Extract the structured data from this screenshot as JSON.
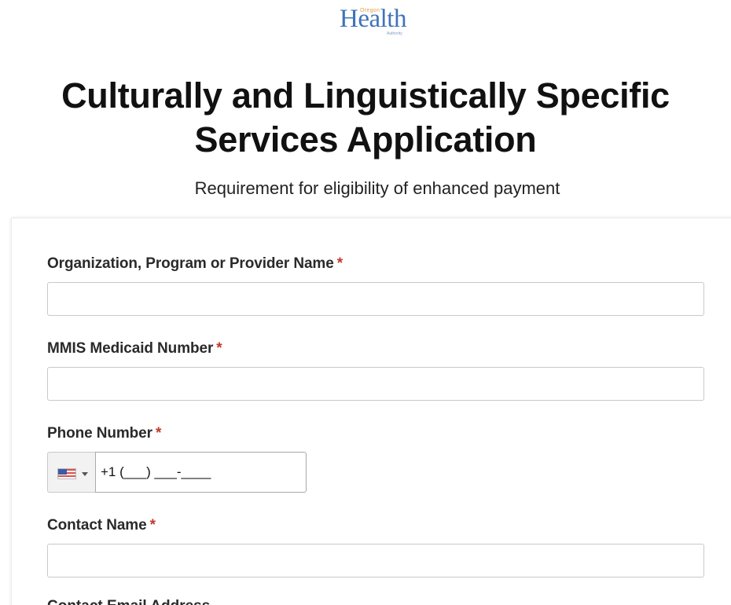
{
  "logo": {
    "word": "Health",
    "small_text": "Oregon",
    "tagline": "Authority"
  },
  "header": {
    "title": "Culturally and Linguistically Specific Services Application",
    "subtitle": "Requirement for eligibility of enhanced payment"
  },
  "form": {
    "required_marker": "*",
    "fields": [
      {
        "label": "Organization, Program or Provider Name",
        "value": "",
        "placeholder": ""
      },
      {
        "label": "MMIS Medicaid Number",
        "value": "",
        "placeholder": ""
      },
      {
        "label": "Phone Number",
        "value": "+1 (___) ___-____",
        "placeholder": "",
        "country": "us-flag-icon"
      },
      {
        "label": "Contact Name",
        "value": "",
        "placeholder": ""
      }
    ],
    "next_label_partial": "Contact Email Address"
  },
  "colors": {
    "logo_blue": "#3f74b8",
    "required_red": "#c0392b",
    "title": "#111111"
  }
}
